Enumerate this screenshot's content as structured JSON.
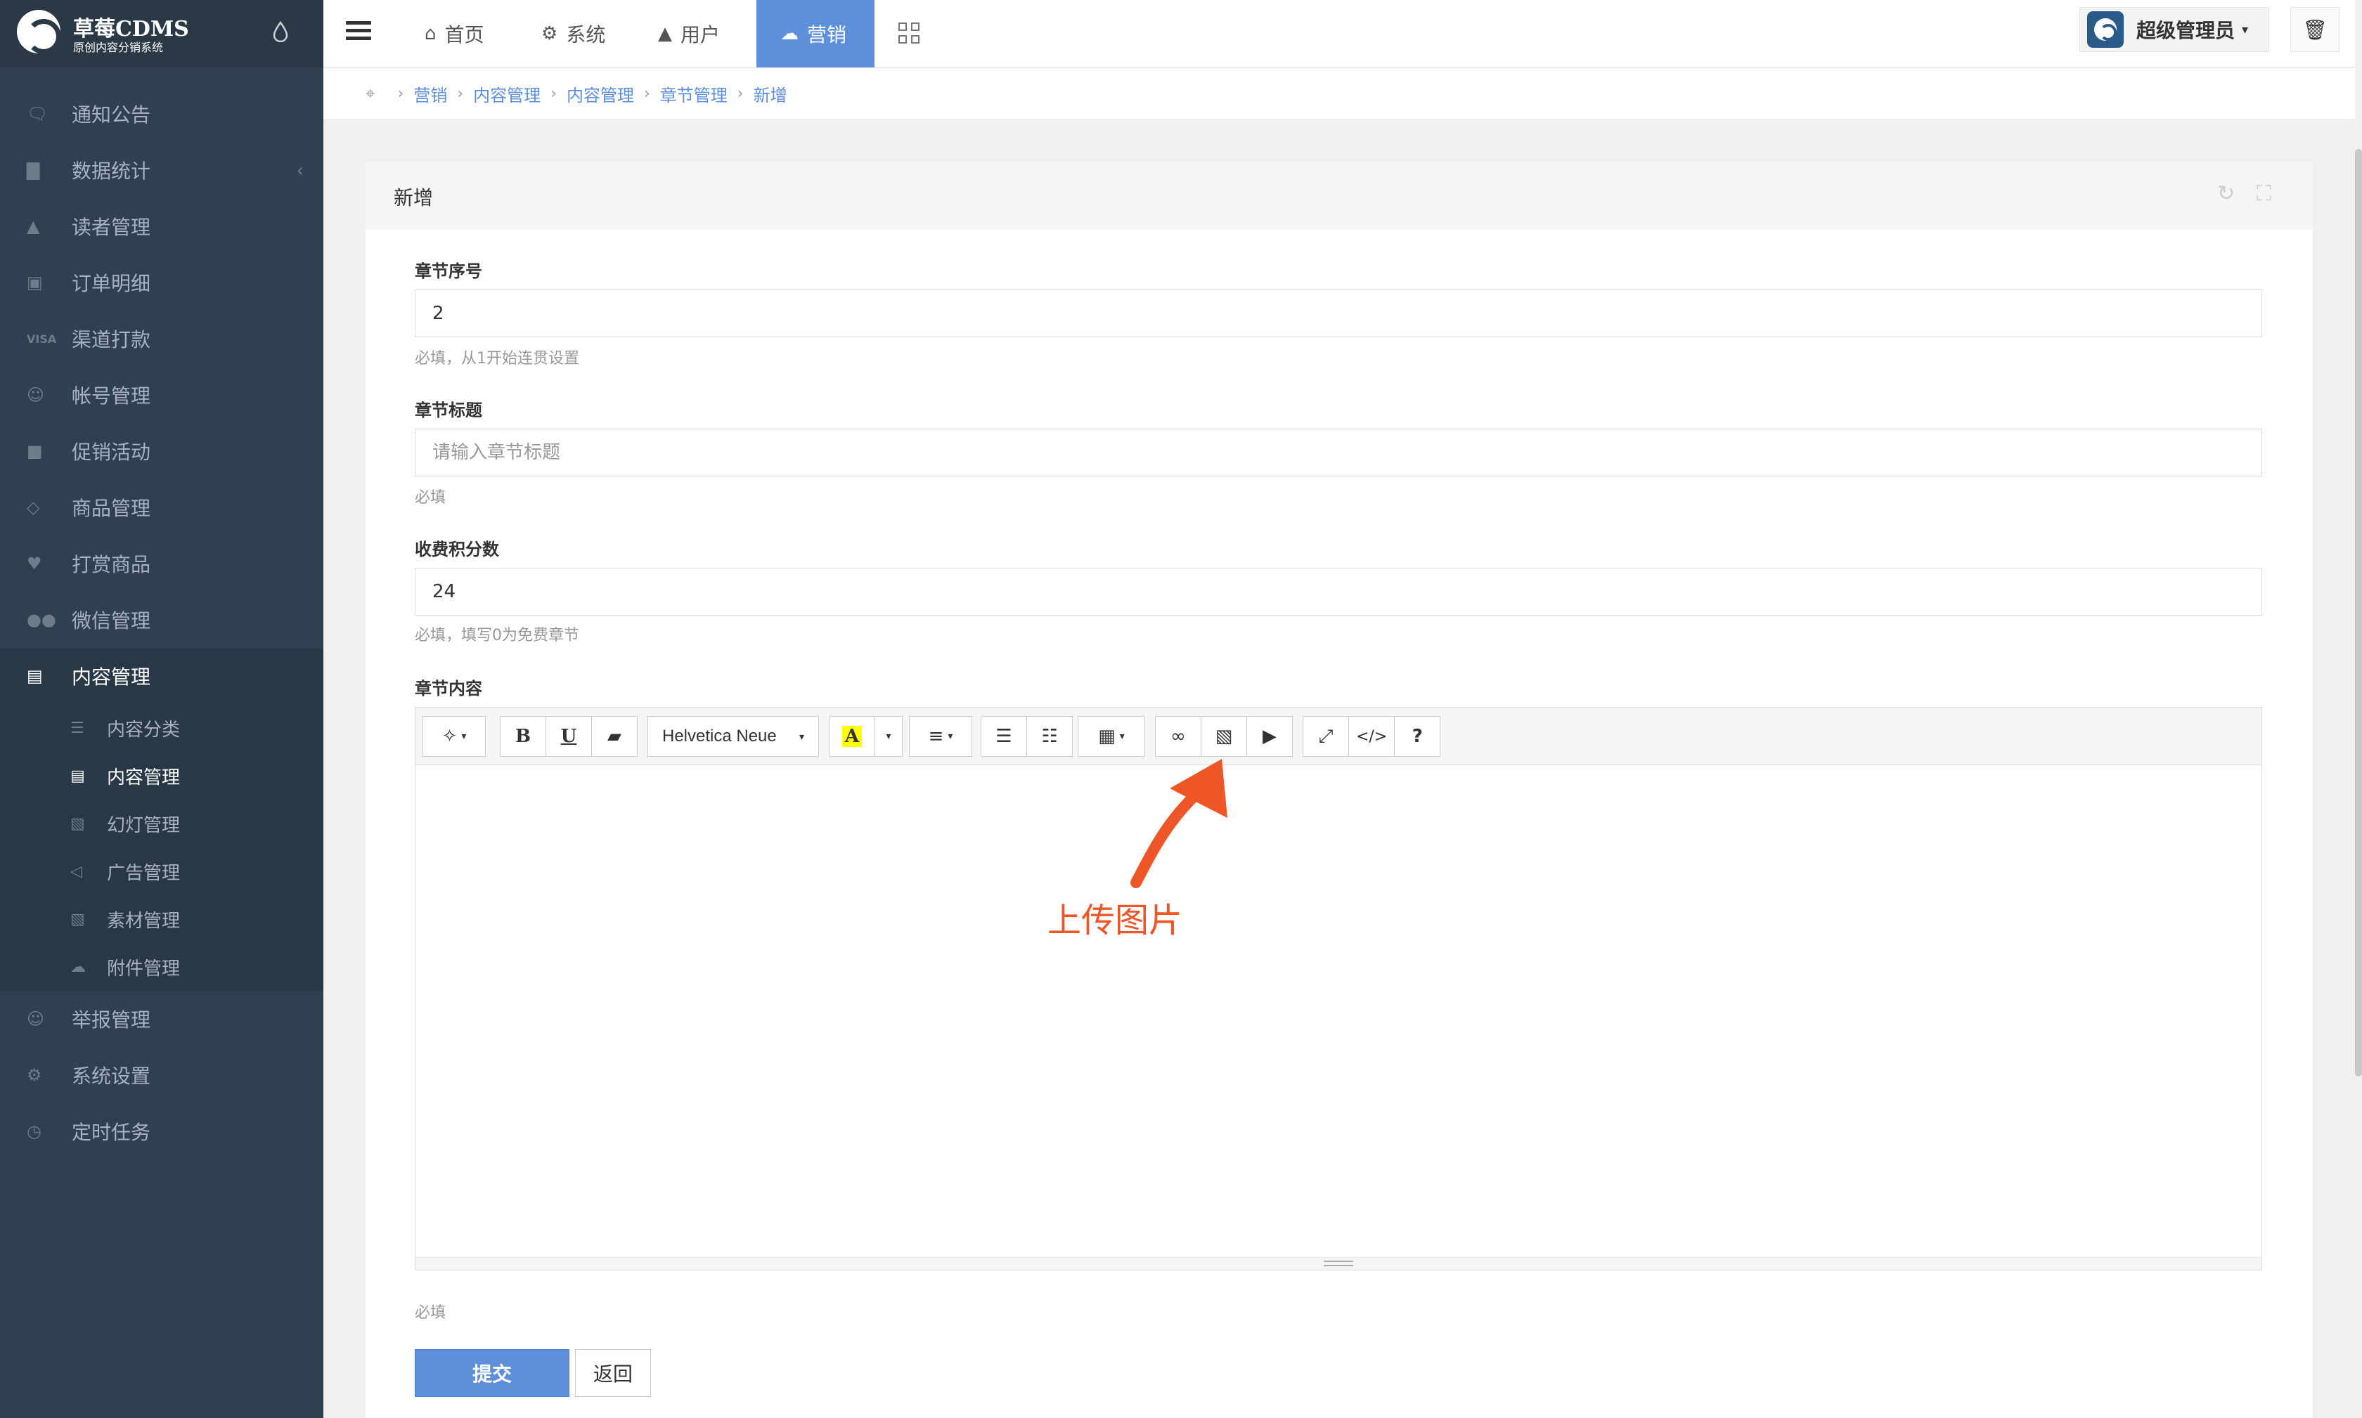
{
  "brand": {
    "name": "草莓CDMS",
    "subtitle": "原创内容分销系统"
  },
  "sidebar": {
    "items": [
      {
        "label": "通知公告",
        "icon": "comment-icon"
      },
      {
        "label": "数据统计",
        "icon": "bar-chart-icon"
      },
      {
        "label": "读者管理",
        "icon": "user-secret-icon"
      },
      {
        "label": "订单明细",
        "icon": "cart-icon"
      },
      {
        "label": "渠道打款",
        "icon": "visa-card-icon"
      },
      {
        "label": "帐号管理",
        "icon": "user-outline-icon"
      },
      {
        "label": "促销活动",
        "icon": "briefcase-icon"
      },
      {
        "label": "商品管理",
        "icon": "diamond-icon"
      },
      {
        "label": "打赏商品",
        "icon": "heart-icon"
      },
      {
        "label": "微信管理",
        "icon": "wechat-icon"
      },
      {
        "label": "内容管理",
        "icon": "book-icon"
      }
    ],
    "sub_items": [
      {
        "label": "内容分类",
        "icon": "list-icon"
      },
      {
        "label": "内容管理",
        "icon": "book-icon"
      },
      {
        "label": "幻灯管理",
        "icon": "image-icon"
      },
      {
        "label": "广告管理",
        "icon": "bullhorn-icon"
      },
      {
        "label": "素材管理",
        "icon": "image-icon"
      },
      {
        "label": "附件管理",
        "icon": "cloud-upload-icon"
      }
    ],
    "bottom_items": [
      {
        "label": "举报管理",
        "icon": "smile-icon"
      },
      {
        "label": "系统设置",
        "icon": "gear-icon"
      },
      {
        "label": "定时任务",
        "icon": "clock-icon"
      }
    ]
  },
  "topbar": {
    "tabs": [
      {
        "label": "首页",
        "icon": "home-icon"
      },
      {
        "label": "系统",
        "icon": "gear-icon"
      },
      {
        "label": "用户",
        "icon": "user-icon"
      },
      {
        "label": "营销",
        "icon": "cloud-icon"
      }
    ],
    "user_name": "超级管理员"
  },
  "breadcrumb": [
    "营销",
    "内容管理",
    "内容管理",
    "章节管理",
    "新增"
  ],
  "panel": {
    "title": "新增"
  },
  "form": {
    "chapter_no": {
      "label": "章节序号",
      "value": "2",
      "help": "必填，从1开始连贯设置"
    },
    "chapter_title": {
      "label": "章节标题",
      "placeholder": "请输入章节标题",
      "value": "",
      "help": "必填"
    },
    "points": {
      "label": "收费积分数",
      "value": "24",
      "help": "必填，填写0为免费章节"
    },
    "content": {
      "label": "章节内容",
      "help": "必填"
    }
  },
  "editor": {
    "font_name": "Helvetica Neue",
    "bold": "B",
    "underline": "U",
    "highlight": "A",
    "help": "?",
    "code": "</>"
  },
  "annotation": {
    "text": "上传图片",
    "color": "#ee5628"
  },
  "buttons": {
    "submit": "提交",
    "back": "返回"
  },
  "colors": {
    "accent": "#5d8fdb",
    "sidebar_bg": "#2f4050",
    "annotation": "#ee5628"
  }
}
